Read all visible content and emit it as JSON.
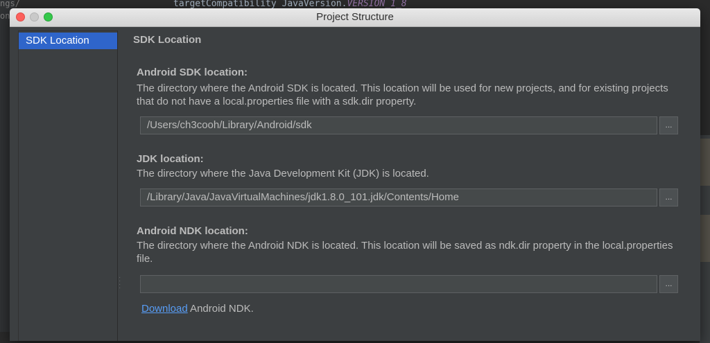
{
  "background_editor": {
    "code_line_prefix": "targetCompatibility JavaVersion.",
    "code_line_constant": "VERSION_1_8",
    "side_text_1": "ngs/",
    "side_text_2": "on"
  },
  "window": {
    "title": "Project Structure"
  },
  "sidebar": {
    "items": [
      {
        "label": "SDK Location",
        "selected": true
      }
    ]
  },
  "content": {
    "section_title": "SDK Location",
    "android_sdk": {
      "heading": "Android SDK location:",
      "description": "The directory where the Android SDK is located. This location will be used for new projects, and for existing projects that do not have a local.properties file with a sdk.dir property.",
      "path": "/Users/ch3cooh/Library/Android/sdk",
      "browse_label": "..."
    },
    "jdk": {
      "heading": "JDK location:",
      "description": "The directory where the Java Development Kit (JDK) is located.",
      "path": "/Library/Java/JavaVirtualMachines/jdk1.8.0_101.jdk/Contents/Home",
      "browse_label": "..."
    },
    "android_ndk": {
      "heading": "Android NDK location:",
      "description": "The directory where the Android NDK is located. This location will be saved as ndk.dir property in the local.properties file.",
      "path": "",
      "browse_label": "...",
      "download_link": "Download",
      "download_suffix": " Android NDK."
    }
  },
  "colors": {
    "accent_selection": "#2f65ca",
    "link": "#589df6",
    "dialog_bg": "#3c3f41"
  }
}
